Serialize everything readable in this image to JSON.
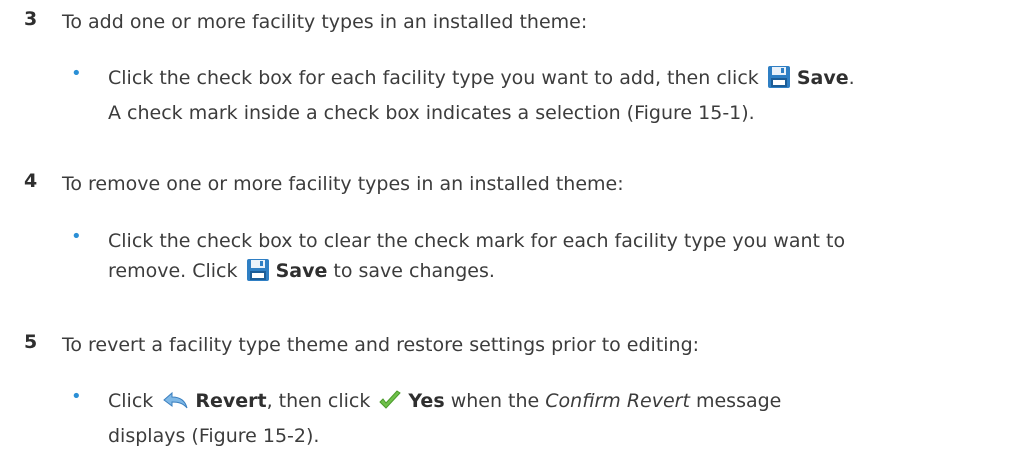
{
  "steps": [
    {
      "number": "3",
      "text": "To add one or more facility types in an installed theme:",
      "bullet_line1_pre": "Click the check box for each facility type you want to add, then click",
      "bullet_line1_bold": "Save",
      "bullet_line1_post": ".",
      "bullet_line2": "A check mark inside a check box indicates a selection (Figure 15-1)."
    },
    {
      "number": "4",
      "text": "To remove one or more facility types in an installed theme:",
      "bullet_line1": "Click the check box to clear the check mark for each facility type you want to",
      "bullet_line2_pre": "remove. Click",
      "bullet_line2_bold": "Save",
      "bullet_line2_post": "to save changes."
    },
    {
      "number": "5",
      "text": "To revert a facility type theme and restore settings prior to editing:",
      "bullet_line1_pre": "Click",
      "bullet_line1_bold1": "Revert",
      "bullet_line1_mid": ", then click",
      "bullet_line1_bold2": "Yes",
      "bullet_line1_mid2": "when the",
      "bullet_line1_italic": "Confirm Revert",
      "bullet_line1_post": "message",
      "bullet_line2": "displays (Figure 15-2)."
    }
  ],
  "bullet_char": "•",
  "icons": {
    "save": "save-disk-icon",
    "revert": "revert-arrow-icon",
    "yes": "checkmark-icon"
  },
  "colors": {
    "bullet": "#2a8fd6",
    "text": "#3c3c3c"
  }
}
